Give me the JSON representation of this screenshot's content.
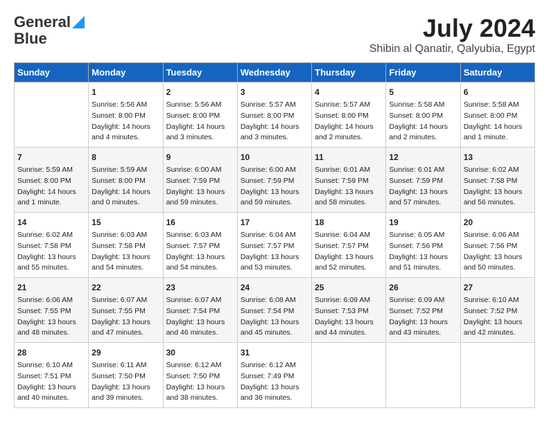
{
  "header": {
    "logo_line1": "General",
    "logo_line2": "Blue",
    "title": "July 2024",
    "subtitle": "Shibin al Qanatir, Qalyubia, Egypt"
  },
  "days_of_week": [
    "Sunday",
    "Monday",
    "Tuesday",
    "Wednesday",
    "Thursday",
    "Friday",
    "Saturday"
  ],
  "weeks": [
    [
      {
        "day": "",
        "content": ""
      },
      {
        "day": "1",
        "content": "Sunrise: 5:56 AM\nSunset: 8:00 PM\nDaylight: 14 hours\nand 4 minutes."
      },
      {
        "day": "2",
        "content": "Sunrise: 5:56 AM\nSunset: 8:00 PM\nDaylight: 14 hours\nand 3 minutes."
      },
      {
        "day": "3",
        "content": "Sunrise: 5:57 AM\nSunset: 8:00 PM\nDaylight: 14 hours\nand 3 minutes."
      },
      {
        "day": "4",
        "content": "Sunrise: 5:57 AM\nSunset: 8:00 PM\nDaylight: 14 hours\nand 2 minutes."
      },
      {
        "day": "5",
        "content": "Sunrise: 5:58 AM\nSunset: 8:00 PM\nDaylight: 14 hours\nand 2 minutes."
      },
      {
        "day": "6",
        "content": "Sunrise: 5:58 AM\nSunset: 8:00 PM\nDaylight: 14 hours\nand 1 minute."
      }
    ],
    [
      {
        "day": "7",
        "content": "Sunrise: 5:59 AM\nSunset: 8:00 PM\nDaylight: 14 hours\nand 1 minute."
      },
      {
        "day": "8",
        "content": "Sunrise: 5:59 AM\nSunset: 8:00 PM\nDaylight: 14 hours\nand 0 minutes."
      },
      {
        "day": "9",
        "content": "Sunrise: 6:00 AM\nSunset: 7:59 PM\nDaylight: 13 hours\nand 59 minutes."
      },
      {
        "day": "10",
        "content": "Sunrise: 6:00 AM\nSunset: 7:59 PM\nDaylight: 13 hours\nand 59 minutes."
      },
      {
        "day": "11",
        "content": "Sunrise: 6:01 AM\nSunset: 7:59 PM\nDaylight: 13 hours\nand 58 minutes."
      },
      {
        "day": "12",
        "content": "Sunrise: 6:01 AM\nSunset: 7:59 PM\nDaylight: 13 hours\nand 57 minutes."
      },
      {
        "day": "13",
        "content": "Sunrise: 6:02 AM\nSunset: 7:58 PM\nDaylight: 13 hours\nand 56 minutes."
      }
    ],
    [
      {
        "day": "14",
        "content": "Sunrise: 6:02 AM\nSunset: 7:58 PM\nDaylight: 13 hours\nand 55 minutes."
      },
      {
        "day": "15",
        "content": "Sunrise: 6:03 AM\nSunset: 7:58 PM\nDaylight: 13 hours\nand 54 minutes."
      },
      {
        "day": "16",
        "content": "Sunrise: 6:03 AM\nSunset: 7:57 PM\nDaylight: 13 hours\nand 54 minutes."
      },
      {
        "day": "17",
        "content": "Sunrise: 6:04 AM\nSunset: 7:57 PM\nDaylight: 13 hours\nand 53 minutes."
      },
      {
        "day": "18",
        "content": "Sunrise: 6:04 AM\nSunset: 7:57 PM\nDaylight: 13 hours\nand 52 minutes."
      },
      {
        "day": "19",
        "content": "Sunrise: 6:05 AM\nSunset: 7:56 PM\nDaylight: 13 hours\nand 51 minutes."
      },
      {
        "day": "20",
        "content": "Sunrise: 6:06 AM\nSunset: 7:56 PM\nDaylight: 13 hours\nand 50 minutes."
      }
    ],
    [
      {
        "day": "21",
        "content": "Sunrise: 6:06 AM\nSunset: 7:55 PM\nDaylight: 13 hours\nand 48 minutes."
      },
      {
        "day": "22",
        "content": "Sunrise: 6:07 AM\nSunset: 7:55 PM\nDaylight: 13 hours\nand 47 minutes."
      },
      {
        "day": "23",
        "content": "Sunrise: 6:07 AM\nSunset: 7:54 PM\nDaylight: 13 hours\nand 46 minutes."
      },
      {
        "day": "24",
        "content": "Sunrise: 6:08 AM\nSunset: 7:54 PM\nDaylight: 13 hours\nand 45 minutes."
      },
      {
        "day": "25",
        "content": "Sunrise: 6:09 AM\nSunset: 7:53 PM\nDaylight: 13 hours\nand 44 minutes."
      },
      {
        "day": "26",
        "content": "Sunrise: 6:09 AM\nSunset: 7:52 PM\nDaylight: 13 hours\nand 43 minutes."
      },
      {
        "day": "27",
        "content": "Sunrise: 6:10 AM\nSunset: 7:52 PM\nDaylight: 13 hours\nand 42 minutes."
      }
    ],
    [
      {
        "day": "28",
        "content": "Sunrise: 6:10 AM\nSunset: 7:51 PM\nDaylight: 13 hours\nand 40 minutes."
      },
      {
        "day": "29",
        "content": "Sunrise: 6:11 AM\nSunset: 7:50 PM\nDaylight: 13 hours\nand 39 minutes."
      },
      {
        "day": "30",
        "content": "Sunrise: 6:12 AM\nSunset: 7:50 PM\nDaylight: 13 hours\nand 38 minutes."
      },
      {
        "day": "31",
        "content": "Sunrise: 6:12 AM\nSunset: 7:49 PM\nDaylight: 13 hours\nand 36 minutes."
      },
      {
        "day": "",
        "content": ""
      },
      {
        "day": "",
        "content": ""
      },
      {
        "day": "",
        "content": ""
      }
    ]
  ]
}
